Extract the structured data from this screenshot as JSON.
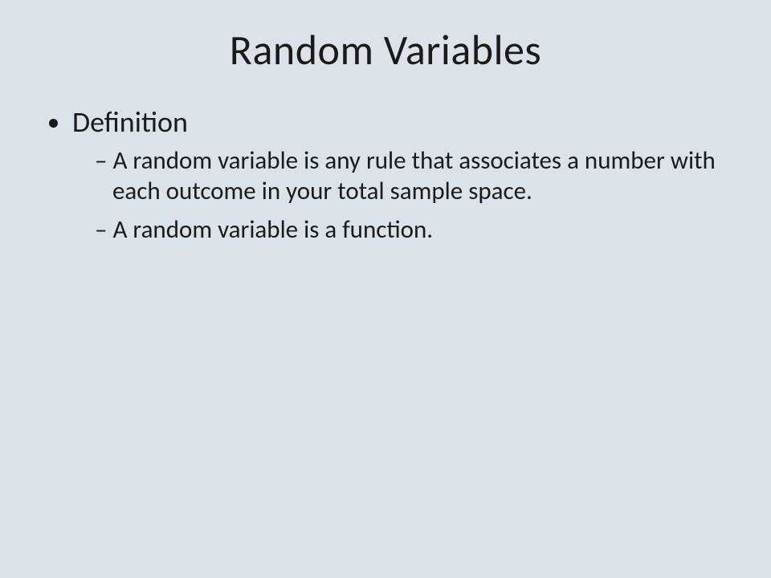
{
  "title": "Random Variables",
  "bullets": {
    "main": "Definition",
    "subs": [
      "A random variable is any rule that associates a number with each outcome in your total sample space.",
      "A random variable is a function."
    ]
  }
}
